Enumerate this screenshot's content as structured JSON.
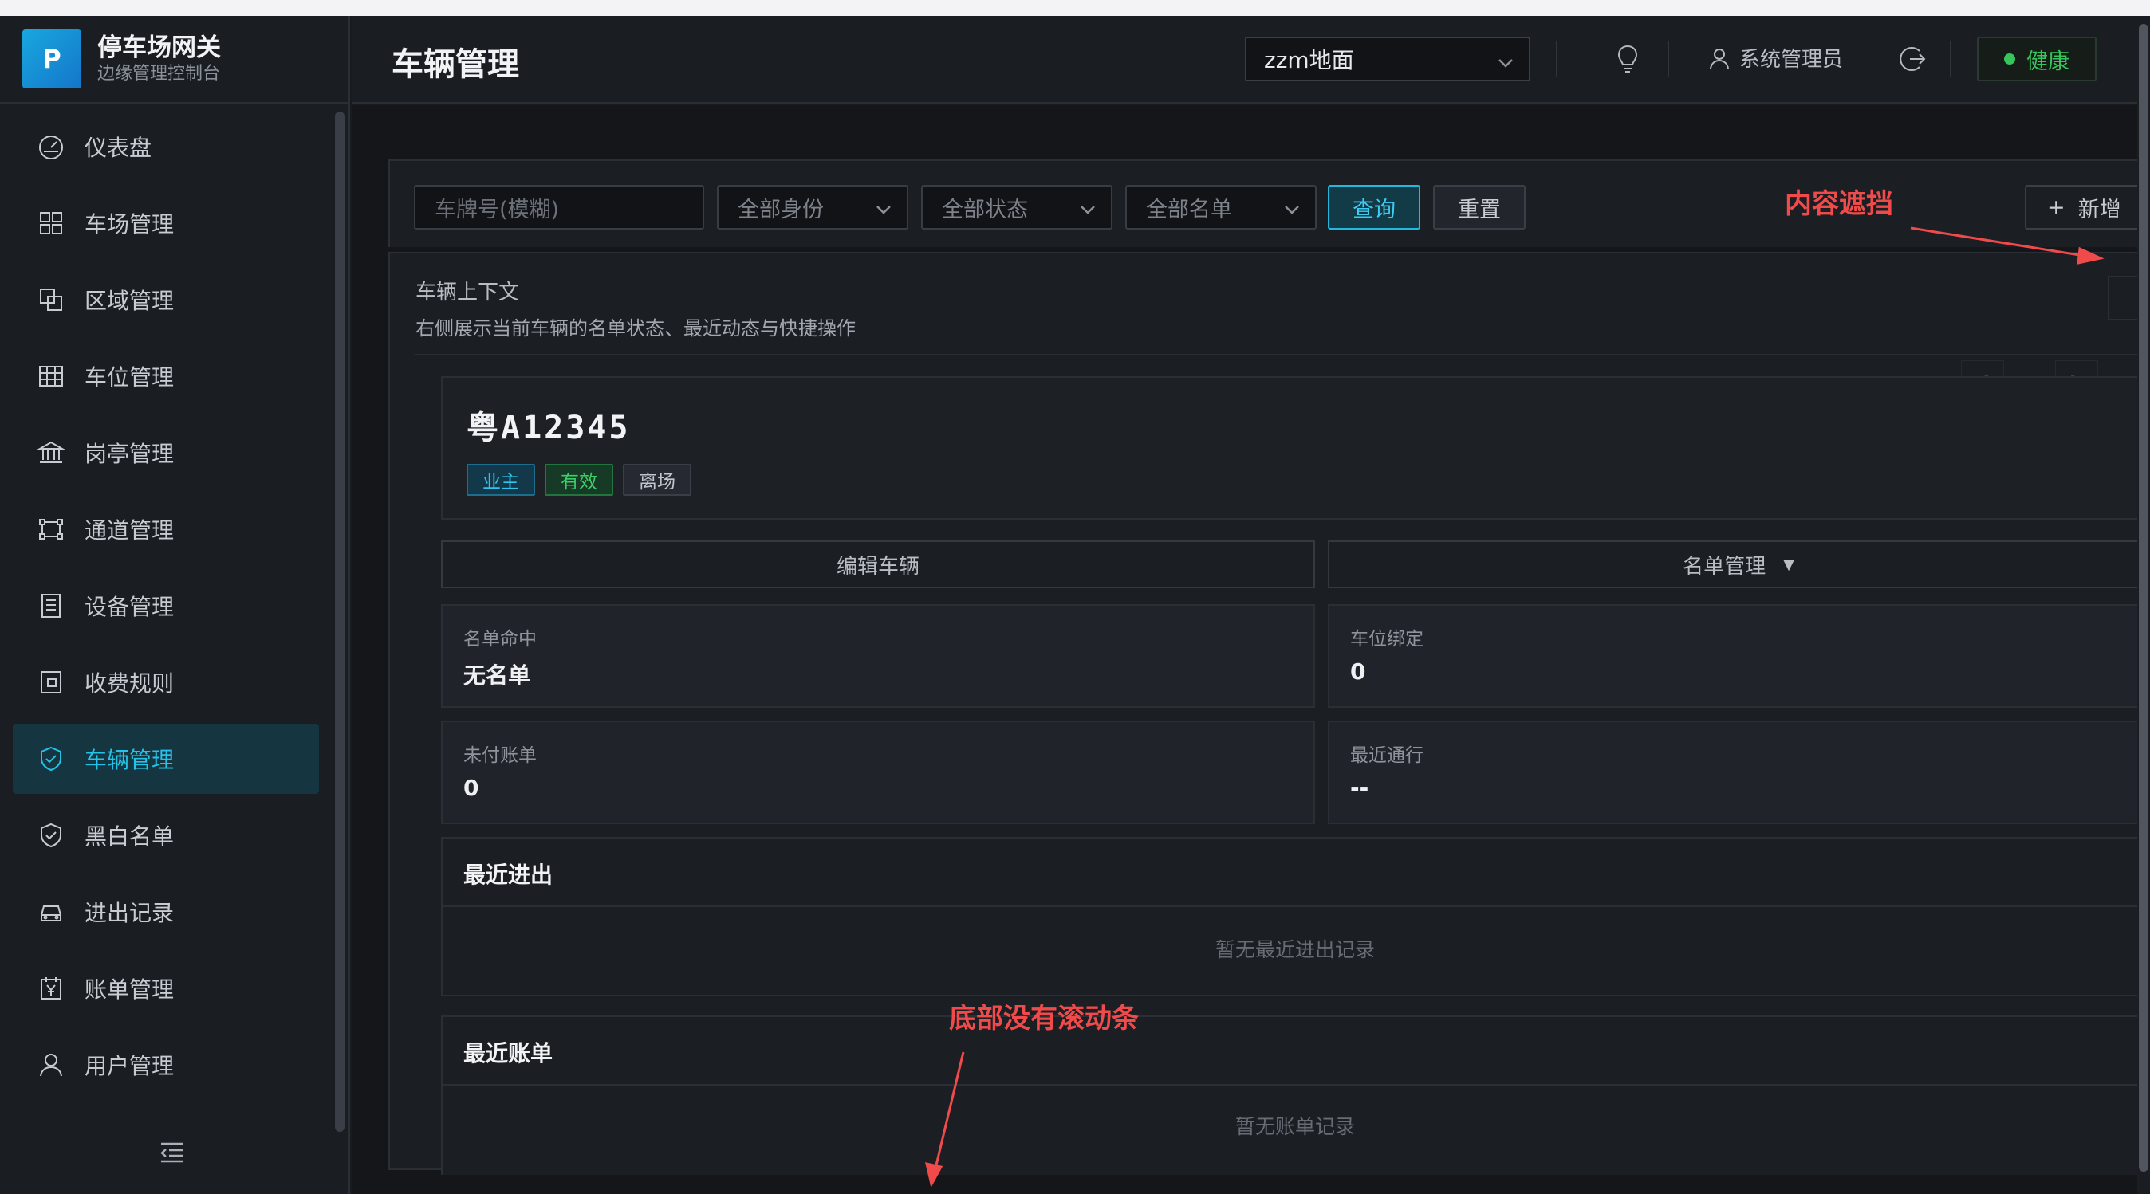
{
  "brand": {
    "logo_letter": "P",
    "title": "停车场网关",
    "subtitle": "边缘管理控制台"
  },
  "sidebar": {
    "items": [
      {
        "label": "仪表盘",
        "icon": "dashboard-icon",
        "active": false
      },
      {
        "label": "车场管理",
        "icon": "grid-icon",
        "active": false
      },
      {
        "label": "区域管理",
        "icon": "layers-icon",
        "active": false
      },
      {
        "label": "车位管理",
        "icon": "table-icon",
        "active": false
      },
      {
        "label": "岗亭管理",
        "icon": "bank-icon",
        "active": false
      },
      {
        "label": "通道管理",
        "icon": "gate-icon",
        "active": false
      },
      {
        "label": "设备管理",
        "icon": "device-icon",
        "active": false
      },
      {
        "label": "收费规则",
        "icon": "wallet-icon",
        "active": false
      },
      {
        "label": "车辆管理",
        "icon": "shield-check-icon",
        "active": true
      },
      {
        "label": "黑白名单",
        "icon": "shield-icon",
        "active": false
      },
      {
        "label": "进出记录",
        "icon": "car-icon",
        "active": false
      },
      {
        "label": "账单管理",
        "icon": "bill-icon",
        "active": false
      },
      {
        "label": "用户管理",
        "icon": "user-icon",
        "active": false
      }
    ]
  },
  "header": {
    "title": "车辆管理",
    "lot_select": "zzm地面",
    "user": "系统管理员",
    "health": "健康",
    "health_color": "#36c55d"
  },
  "toolbar": {
    "plate_placeholder": "车牌号(模糊)",
    "identity_select": "全部身份",
    "status_select": "全部状态",
    "list_select": "全部名单",
    "query_label": "查询",
    "reset_label": "重置",
    "new_label": "新增"
  },
  "context": {
    "title": "车辆上下文",
    "subtitle": "右侧展示当前车辆的名单状态、最近动态与快捷操作",
    "plate": "粤A12345",
    "tags": {
      "owner": "业主",
      "valid": "有效",
      "left": "离场"
    },
    "edit_label": "编辑车辆",
    "list_mgmt_label": "名单管理",
    "stats": {
      "list_hit": {
        "label": "名单命中",
        "value": "无名单"
      },
      "space_bind": {
        "label": "车位绑定",
        "value": "0"
      },
      "unpaid": {
        "label": "未付账单",
        "value": "0"
      },
      "last_pass": {
        "label": "最近通行",
        "value": "--"
      }
    },
    "recent_io": {
      "title": "最近进出",
      "empty": "暂无最近进出记录"
    },
    "recent_bill": {
      "title": "最近账单",
      "empty": "暂无账单记录"
    }
  },
  "annotations": {
    "occlusion": "内容遮挡",
    "no_scrollbar": "底部没有滚动条",
    "color": "#f04a4a"
  },
  "accent_color": "#27c2e8"
}
